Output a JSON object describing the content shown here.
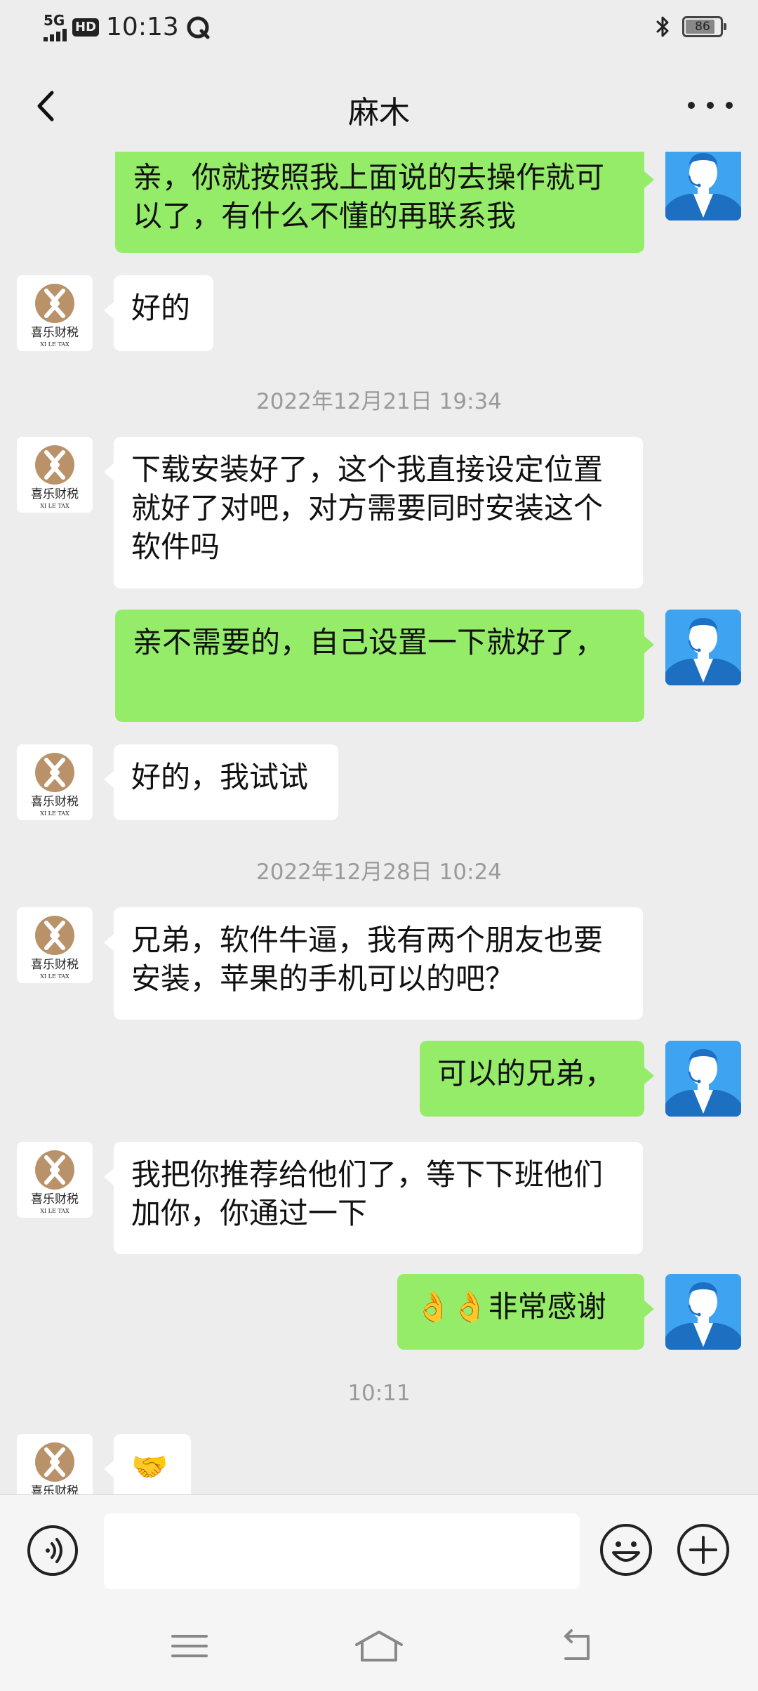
{
  "status_bar": {
    "network": "5G",
    "hd": "HD",
    "time": "10:13",
    "battery_level": "86",
    "battery_fraction": 0.86
  },
  "header": {
    "title": "麻木"
  },
  "logo": {
    "name": "喜乐财税",
    "sub": "XI LE TAX"
  },
  "messages": [
    {
      "from": "agent",
      "text": "亲，你就按照我上面说的去操作就可以了，有什么不懂的再联系我"
    },
    {
      "from": "customer",
      "text": "好的"
    },
    {
      "timestamp": "2022年12月21日 19:34"
    },
    {
      "from": "customer",
      "text": "下载安装好了，这个我直接设定位置就好了对吧，对方需要同时安装这个软件吗"
    },
    {
      "from": "agent",
      "text": "亲不需要的，自己设置一下就好了，"
    },
    {
      "from": "customer",
      "text": "好的，我试试"
    },
    {
      "timestamp": "2022年12月28日 10:24"
    },
    {
      "from": "customer",
      "text": "兄弟，软件牛逼，我有两个朋友也要安装，苹果的手机可以的吧？"
    },
    {
      "from": "agent",
      "text": "可以的兄弟，"
    },
    {
      "from": "customer",
      "text": "我把你推荐给他们了，等下下班他们加你，你通过一下"
    },
    {
      "from": "agent",
      "text": "👌👌非常感谢"
    },
    {
      "timestamp": "10:11"
    },
    {
      "from": "customer",
      "text": "🤝"
    }
  ],
  "icons": {
    "back": "back-arrow-icon",
    "more": "more-dots-icon",
    "voice": "voice-icon",
    "emoji": "emoji-icon",
    "plus": "plus-icon",
    "nav_menu": "menu-icon",
    "nav_home": "home-icon",
    "nav_back": "back-icon"
  },
  "colors": {
    "background": "#ededed",
    "outgoing_bubble": "#95ec69",
    "incoming_bubble": "#ffffff",
    "agent_avatar": "#3ea3f0",
    "logo_gold": "#b9926a"
  }
}
